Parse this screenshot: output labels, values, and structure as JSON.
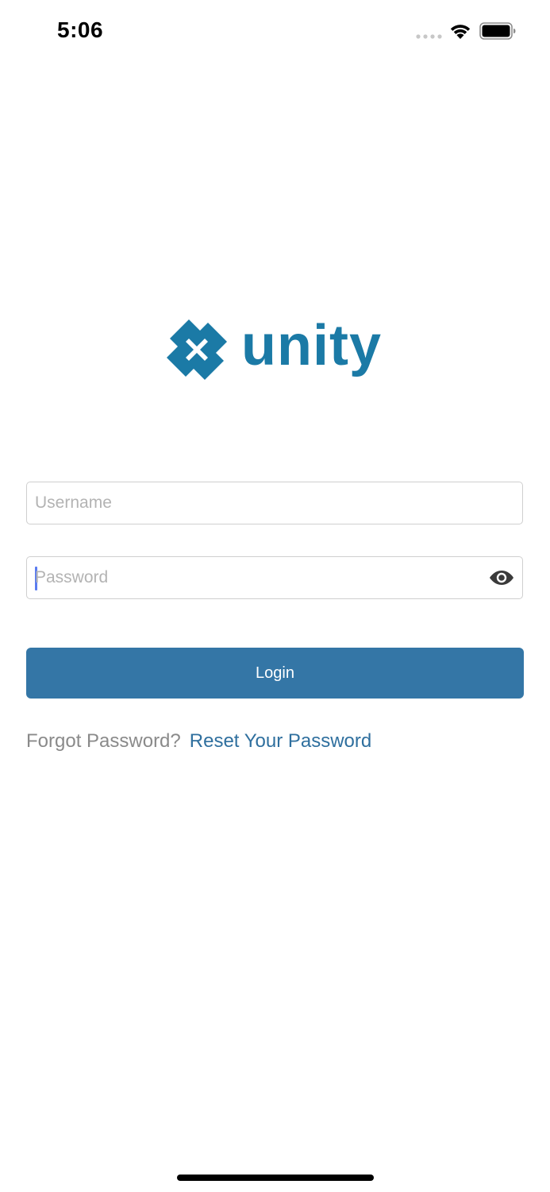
{
  "status_bar": {
    "time": "5:06"
  },
  "brand": {
    "name": "unity",
    "color": "#1b7aa6"
  },
  "login_form": {
    "username": {
      "placeholder": "Username",
      "value": ""
    },
    "password": {
      "placeholder": "Password",
      "value": "",
      "toggle_icon": "eye-icon"
    },
    "login_button_label": "Login",
    "button_color": "#3476a6"
  },
  "forgot_password": {
    "prompt": "Forgot Password?",
    "link_label": "Reset Your Password",
    "link_color": "#2f6f9e"
  }
}
